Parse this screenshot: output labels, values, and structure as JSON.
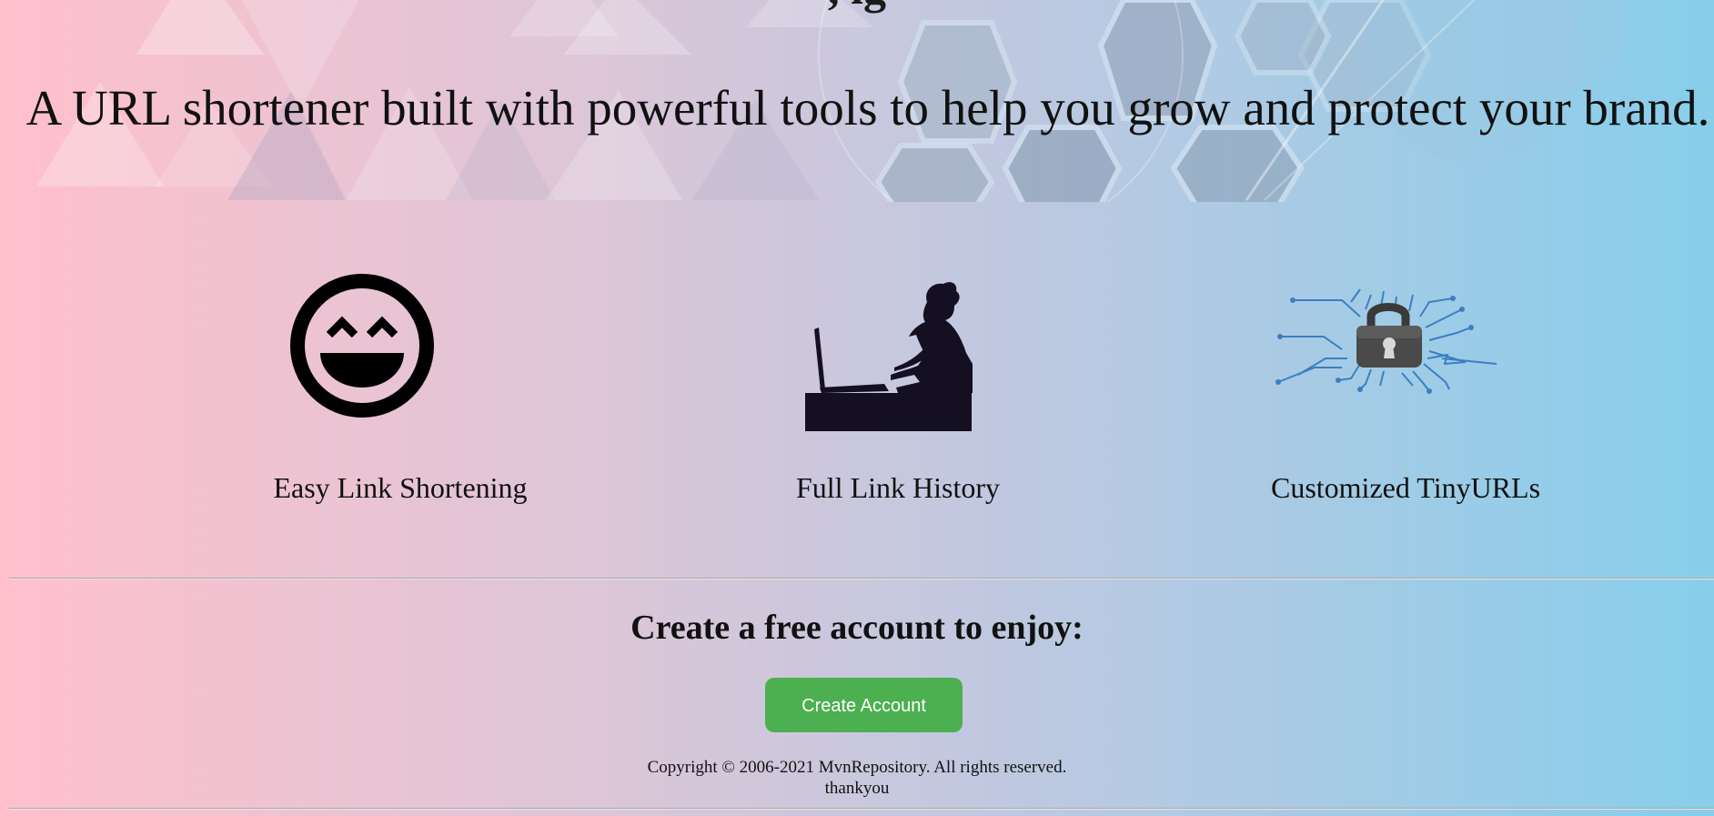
{
  "hero": {
    "cut_title": ", ig",
    "tagline": "A URL shortener built with powerful tools to help you grow and protect your brand."
  },
  "features": [
    {
      "label": "Easy Link Shortening",
      "icon": "smiley-face-icon"
    },
    {
      "label": "Full Link History",
      "icon": "woman-at-laptop-icon"
    },
    {
      "label": "Customized TinyURLs",
      "icon": "circuit-padlock-icon"
    }
  ],
  "cta": {
    "heading": "Create a free account to enjoy:",
    "button_label": "Create Account",
    "button_color": "#4caf50"
  },
  "footer": {
    "copyright": "Copyright © 2006-2021 MvnRepository. All rights reserved.",
    "thanks": "thankyou"
  },
  "colors": {
    "gradient_start": "#ffc0cb",
    "gradient_end": "#87ceeb",
    "text": "#111111"
  }
}
